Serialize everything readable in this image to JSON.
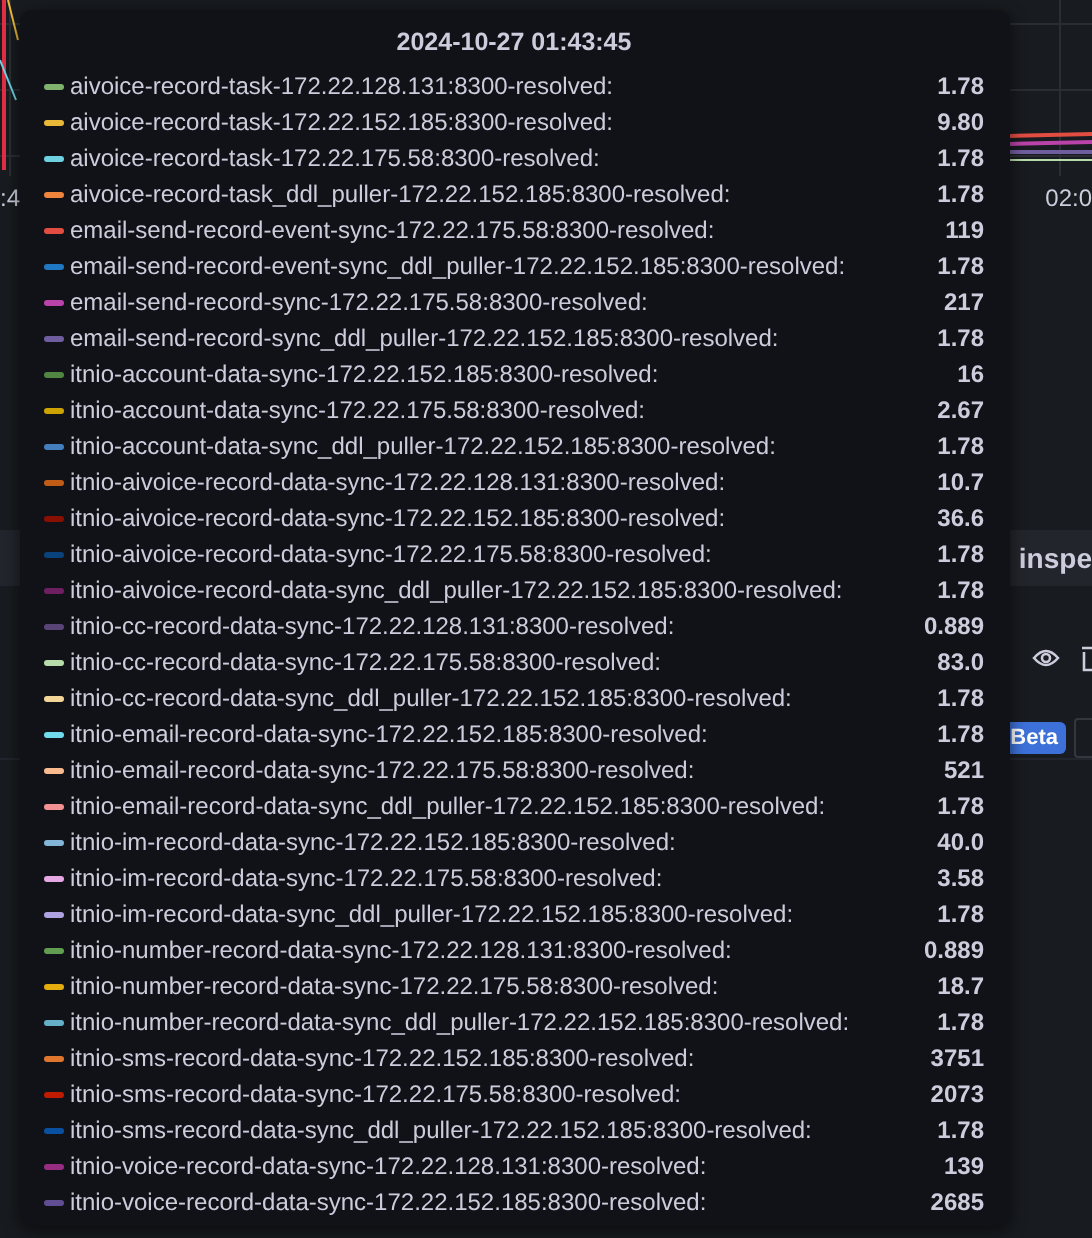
{
  "background": {
    "axis_labels": [
      ":4",
      "02:0"
    ],
    "panel_header": "inspe",
    "badge": "Beta"
  },
  "tooltip": {
    "time": "2024-10-27 01:43:45",
    "series": [
      {
        "name": "aivoice-record-task-172.22.128.131:8300-resolved:",
        "value": "1.78",
        "color": "#7eb26d"
      },
      {
        "name": "aivoice-record-task-172.22.152.185:8300-resolved:",
        "value": "9.80",
        "color": "#eab839"
      },
      {
        "name": "aivoice-record-task-172.22.175.58:8300-resolved:",
        "value": "1.78",
        "color": "#6ed0e0"
      },
      {
        "name": "aivoice-record-task_ddl_puller-172.22.152.185:8300-resolved:",
        "value": "1.78",
        "color": "#ef843c"
      },
      {
        "name": "email-send-record-event-sync-172.22.175.58:8300-resolved:",
        "value": "119",
        "color": "#e24d42"
      },
      {
        "name": "email-send-record-event-sync_ddl_puller-172.22.152.185:8300-resolved:",
        "value": "1.78",
        "color": "#1f78c1"
      },
      {
        "name": "email-send-record-sync-172.22.175.58:8300-resolved:",
        "value": "217",
        "color": "#ba43a9"
      },
      {
        "name": "email-send-record-sync_ddl_puller-172.22.152.185:8300-resolved:",
        "value": "1.78",
        "color": "#705da0"
      },
      {
        "name": "itnio-account-data-sync-172.22.152.185:8300-resolved:",
        "value": "16",
        "color": "#508642"
      },
      {
        "name": "itnio-account-data-sync-172.22.175.58:8300-resolved:",
        "value": "2.67",
        "color": "#cca300"
      },
      {
        "name": "itnio-account-data-sync_ddl_puller-172.22.152.185:8300-resolved:",
        "value": "1.78",
        "color": "#447ebc"
      },
      {
        "name": "itnio-aivoice-record-data-sync-172.22.128.131:8300-resolved:",
        "value": "10.7",
        "color": "#c15c17"
      },
      {
        "name": "itnio-aivoice-record-data-sync-172.22.152.185:8300-resolved:",
        "value": "36.6",
        "color": "#890f02"
      },
      {
        "name": "itnio-aivoice-record-data-sync-172.22.175.58:8300-resolved:",
        "value": "1.78",
        "color": "#0a437c"
      },
      {
        "name": "itnio-aivoice-record-data-sync_ddl_puller-172.22.152.185:8300-resolved:",
        "value": "1.78",
        "color": "#6d1f62"
      },
      {
        "name": "itnio-cc-record-data-sync-172.22.128.131:8300-resolved:",
        "value": "0.889",
        "color": "#584477"
      },
      {
        "name": "itnio-cc-record-data-sync-172.22.175.58:8300-resolved:",
        "value": "83.0",
        "color": "#b7dbab"
      },
      {
        "name": "itnio-cc-record-data-sync_ddl_puller-172.22.152.185:8300-resolved:",
        "value": "1.78",
        "color": "#f4d598"
      },
      {
        "name": "itnio-email-record-data-sync-172.22.152.185:8300-resolved:",
        "value": "1.78",
        "color": "#70dbed"
      },
      {
        "name": "itnio-email-record-data-sync-172.22.175.58:8300-resolved:",
        "value": "521",
        "color": "#f9ba8f"
      },
      {
        "name": "itnio-email-record-data-sync_ddl_puller-172.22.152.185:8300-resolved:",
        "value": "1.78",
        "color": "#f29191"
      },
      {
        "name": "itnio-im-record-data-sync-172.22.152.185:8300-resolved:",
        "value": "40.0",
        "color": "#82b5d8"
      },
      {
        "name": "itnio-im-record-data-sync-172.22.175.58:8300-resolved:",
        "value": "3.58",
        "color": "#e5a8e2"
      },
      {
        "name": "itnio-im-record-data-sync_ddl_puller-172.22.152.185:8300-resolved:",
        "value": "1.78",
        "color": "#aea2e0"
      },
      {
        "name": "itnio-number-record-data-sync-172.22.128.131:8300-resolved:",
        "value": "0.889",
        "color": "#629e51"
      },
      {
        "name": "itnio-number-record-data-sync-172.22.175.58:8300-resolved:",
        "value": "18.7",
        "color": "#e5ac0e"
      },
      {
        "name": "itnio-number-record-data-sync_ddl_puller-172.22.152.185:8300-resolved:",
        "value": "1.78",
        "color": "#64b0c8"
      },
      {
        "name": "itnio-sms-record-data-sync-172.22.152.185:8300-resolved:",
        "value": "3751",
        "color": "#e0752d"
      },
      {
        "name": "itnio-sms-record-data-sync-172.22.175.58:8300-resolved:",
        "value": "2073",
        "color": "#bf1b00"
      },
      {
        "name": "itnio-sms-record-data-sync_ddl_puller-172.22.152.185:8300-resolved:",
        "value": "1.78",
        "color": "#0a50a1"
      },
      {
        "name": "itnio-voice-record-data-sync-172.22.128.131:8300-resolved:",
        "value": "139",
        "color": "#962d82"
      },
      {
        "name": "itnio-voice-record-data-sync-172.22.152.185:8300-resolved:",
        "value": "2685",
        "color": "#614d93"
      }
    ]
  }
}
